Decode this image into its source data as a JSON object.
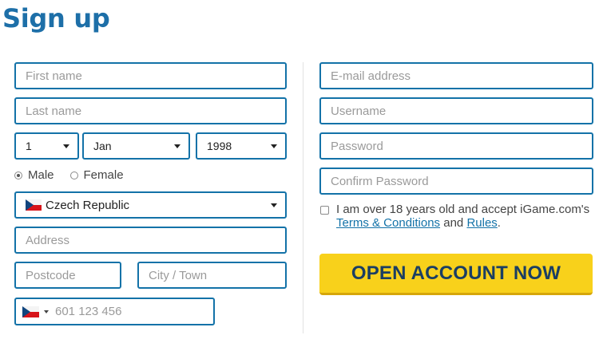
{
  "title": "Sign up",
  "left": {
    "first_name_placeholder": "First name",
    "last_name_placeholder": "Last name",
    "dob": {
      "day": "1",
      "month": "Jan",
      "year": "1998"
    },
    "gender": {
      "male": "Male",
      "female": "Female",
      "selected": "Male"
    },
    "country": {
      "value": "Czech Republic",
      "flag": "czech-flag-icon"
    },
    "address_placeholder": "Address",
    "postcode_placeholder": "Postcode",
    "city_placeholder": "City / Town",
    "phone": {
      "flag": "czech-flag-icon",
      "placeholder": "601 123 456"
    }
  },
  "right": {
    "email_placeholder": "E-mail address",
    "username_placeholder": "Username",
    "password_placeholder": "Password",
    "confirm_password_placeholder": "Confirm Password",
    "consent": {
      "text_before": "I am over 18 years old and accept iGame.com's ",
      "terms_link": "Terms & Conditions",
      "and": " and ",
      "rules_link": "Rules",
      "period": ".",
      "checked": false
    },
    "cta_label": "OPEN ACCOUNT NOW"
  },
  "colors": {
    "accent": "#1372a8",
    "title": "#1d6fa8",
    "cta_bg": "#f8d11b",
    "cta_text": "#1b3e63"
  }
}
